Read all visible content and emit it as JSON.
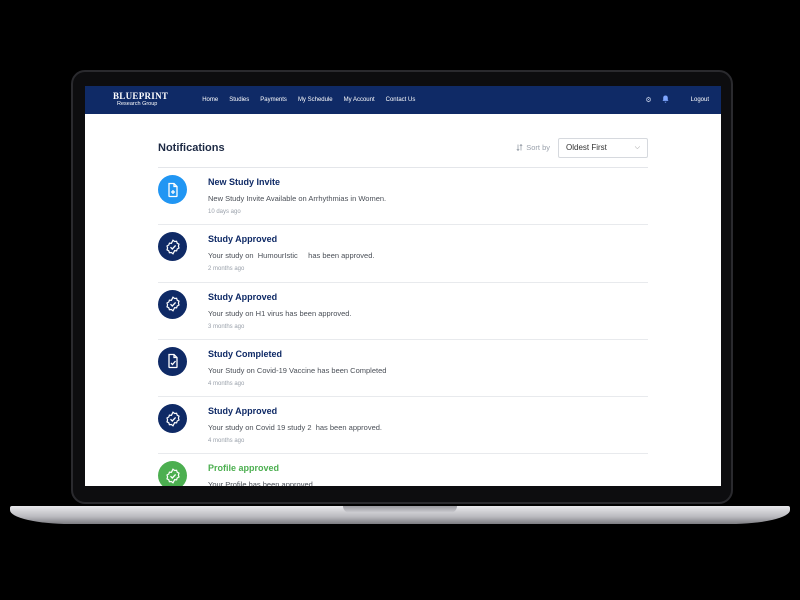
{
  "navbar": {
    "brand_name": "BLUEPRINT",
    "brand_sub": "Research Group",
    "links": [
      "Home",
      "Studies",
      "Payments",
      "My Schedule",
      "My Account",
      "Contact Us"
    ],
    "logout": "Logout"
  },
  "page": {
    "title": "Notifications",
    "sort_label": "Sort by",
    "sort_value": "Oldest First"
  },
  "notifications": [
    {
      "title": "New Study Invite",
      "message": "New Study Invite Available on Arrhythmias in Women.",
      "time": "10 days ago",
      "icon": "document-add-icon",
      "color": "#2196f3"
    },
    {
      "title": "Study Approved",
      "message": "Your study on  HumourIstic     has been approved.",
      "time": "2 months ago",
      "icon": "check-badge-icon",
      "color": "#0f2a66"
    },
    {
      "title": "Study Approved",
      "message": "Your study on H1 virus has been approved.",
      "time": "3 months ago",
      "icon": "check-badge-icon",
      "color": "#0f2a66"
    },
    {
      "title": "Study Completed",
      "message": "Your Study on Covid-19 Vaccine has been Completed",
      "time": "4 months ago",
      "icon": "document-check-icon",
      "color": "#0f2a66"
    },
    {
      "title": "Study Approved",
      "message": "Your study on Covid 19 study 2  has been approved.",
      "time": "4 months ago",
      "icon": "check-badge-icon",
      "color": "#0f2a66"
    },
    {
      "title": "Profile approved",
      "message": "Your Profile has been approved.",
      "time": "",
      "icon": "check-badge-icon",
      "color": "#4caf50"
    }
  ]
}
